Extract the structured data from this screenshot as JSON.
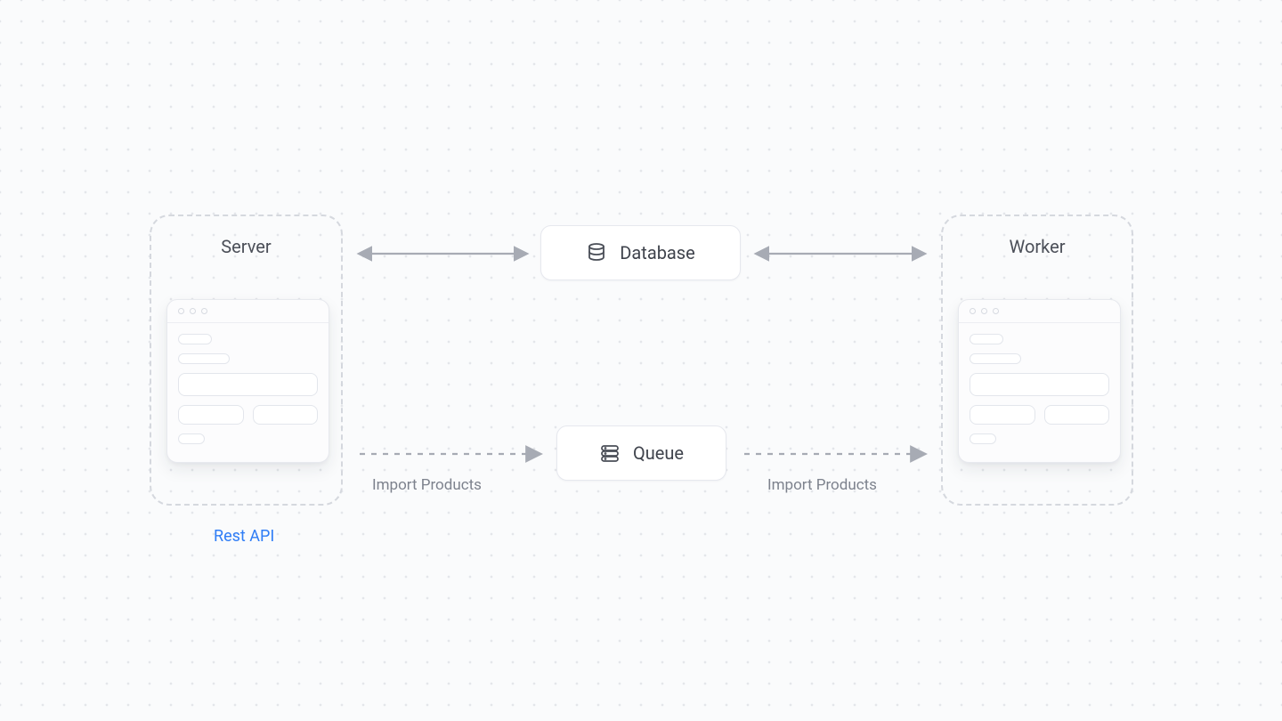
{
  "nodes": {
    "server": {
      "title": "Server",
      "sublabel": "Rest API"
    },
    "worker": {
      "title": "Worker"
    },
    "database": {
      "label": "Database"
    },
    "queue": {
      "label": "Queue"
    }
  },
  "edges": {
    "server_to_queue_label": "Import Products",
    "queue_to_worker_label": "Import Products"
  },
  "colors": {
    "link": "#2f7df6",
    "text": "#4b4f58",
    "muted": "#7d828d",
    "arrow": "#a7abb4"
  }
}
